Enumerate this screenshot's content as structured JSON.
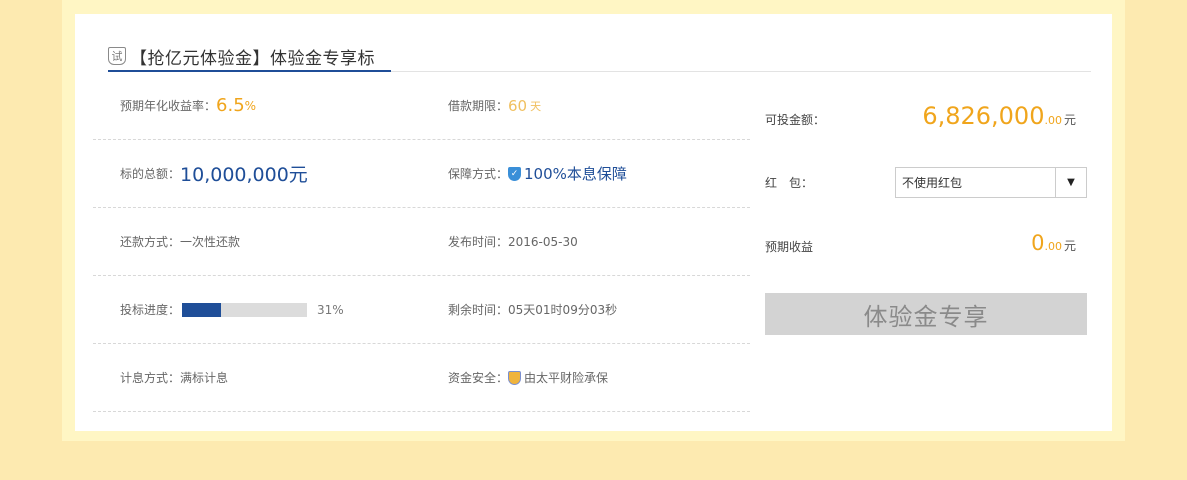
{
  "title": {
    "icon_char": "试",
    "text": "【抢亿元体验金】体验金专享标"
  },
  "details": {
    "rate_label": "预期年化收益率：",
    "rate_value": "6.5",
    "rate_unit": "%",
    "term_label": "借款期限：",
    "term_value": "60",
    "term_unit": "天",
    "total_label": "标的总额：",
    "total_value": "10,000,000元",
    "guarantee_label": "保障方式：",
    "guarantee_icon_char": "✓",
    "guarantee_value": "100%本息保障",
    "repay_label": "还款方式：",
    "repay_value": "一次性还款",
    "publish_label": "发布时间：",
    "publish_value": "2016-05-30",
    "progress_label": "投标进度：",
    "progress_fraction": 0.31,
    "progress_text": "31%",
    "remaining_label": "剩余时间：",
    "remaining_value": "05天01时09分03秒",
    "interest_label": "计息方式：",
    "interest_value": "满标计息",
    "safety_label": "资金安全：",
    "safety_value": "由太平财险承保"
  },
  "side": {
    "investable_label": "可投金额：",
    "investable_int": "6,826,000",
    "investable_dec": ".00",
    "investable_unit": "元",
    "redpacket_label": "红　包：",
    "redpacket_selected": "不使用红包",
    "redpacket_arrow": "▼",
    "expected_label": "预期收益",
    "expected_int": "0",
    "expected_dec": ".00",
    "expected_unit": "元",
    "action_label": "体验金专享"
  },
  "colors": {
    "accent_orange": "#f0a51c",
    "accent_blue": "#1f4e98",
    "page_bg": "#fdeab0"
  }
}
